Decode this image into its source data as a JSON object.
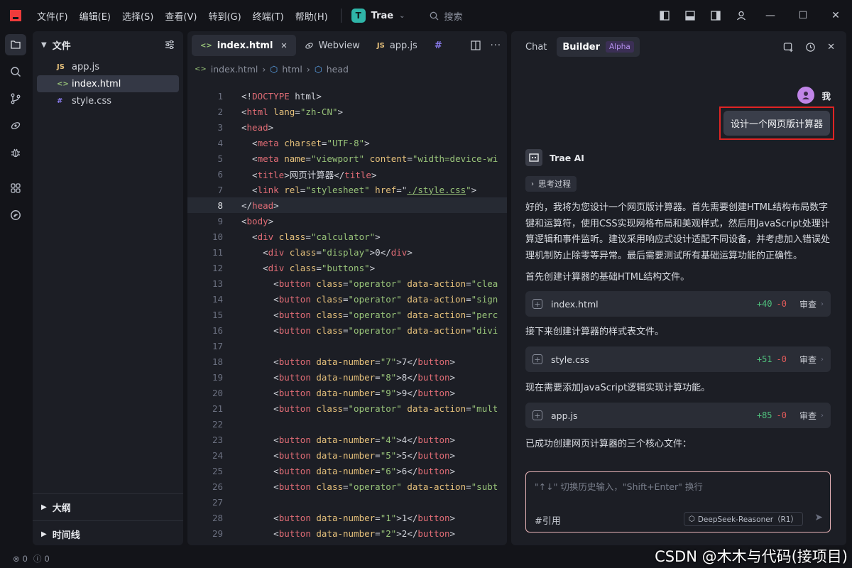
{
  "menu": [
    "文件(F)",
    "编辑(E)",
    "选择(S)",
    "查看(V)",
    "转到(G)",
    "终端(T)",
    "帮助(H)"
  ],
  "workspace": {
    "badge": "T",
    "name": "Trae"
  },
  "search": {
    "placeholder": "搜索"
  },
  "sidebar": {
    "title": "文件",
    "files": [
      {
        "icon": "JS",
        "name": "app.js",
        "color": "#e5c07b"
      },
      {
        "icon": "<>",
        "name": "index.html",
        "color": "#98c379"
      },
      {
        "icon": "#",
        "name": "style.css",
        "color": "#8b7cf0"
      }
    ],
    "outline": "大纲",
    "timeline": "时间线"
  },
  "editor": {
    "tabs": [
      {
        "icon": "<>",
        "label": "index.html"
      },
      {
        "icon": "webview",
        "label": "Webview"
      },
      {
        "icon": "JS",
        "label": "app.js"
      },
      {
        "icon": "#",
        "label": ""
      }
    ],
    "breadcrumb": [
      "index.html",
      "html",
      "head"
    ],
    "current_line": 8,
    "lines": [
      [
        [
          "pl",
          "<!"
        ],
        [
          "tag",
          "DOCTYPE"
        ],
        [
          "pl",
          " html>"
        ]
      ],
      [
        [
          "pl",
          "<"
        ],
        [
          "tag",
          "html"
        ],
        [
          "attr",
          " lang"
        ],
        [
          "pl",
          "="
        ],
        [
          "str",
          "\"zh-CN\""
        ],
        [
          "pl",
          ">"
        ]
      ],
      [
        [
          "pl",
          "<"
        ],
        [
          "tag",
          "head"
        ],
        [
          "pl",
          ">"
        ]
      ],
      [
        [
          "pl",
          "  <"
        ],
        [
          "tag",
          "meta"
        ],
        [
          "attr",
          " charset"
        ],
        [
          "pl",
          "="
        ],
        [
          "str",
          "\"UTF-8\""
        ],
        [
          "pl",
          ">"
        ]
      ],
      [
        [
          "pl",
          "  <"
        ],
        [
          "tag",
          "meta"
        ],
        [
          "attr",
          " name"
        ],
        [
          "pl",
          "="
        ],
        [
          "str",
          "\"viewport\""
        ],
        [
          "attr",
          " content"
        ],
        [
          "pl",
          "="
        ],
        [
          "str",
          "\"width=device-wi"
        ]
      ],
      [
        [
          "pl",
          "  <"
        ],
        [
          "tag",
          "title"
        ],
        [
          "pl",
          ">网页计算器</"
        ],
        [
          "tag",
          "title"
        ],
        [
          "pl",
          ">"
        ]
      ],
      [
        [
          "pl",
          "  <"
        ],
        [
          "tag",
          "link"
        ],
        [
          "attr",
          " rel"
        ],
        [
          "pl",
          "="
        ],
        [
          "str",
          "\"stylesheet\""
        ],
        [
          "attr",
          " href"
        ],
        [
          "pl",
          "=\""
        ],
        [
          "lnk",
          "./style.css"
        ],
        [
          "str",
          "\""
        ],
        [
          "pl",
          ">"
        ]
      ],
      [
        [
          "pl",
          "</"
        ],
        [
          "tag",
          "head"
        ],
        [
          "pl",
          ">"
        ]
      ],
      [
        [
          "pl",
          "<"
        ],
        [
          "tag",
          "body"
        ],
        [
          "pl",
          ">"
        ]
      ],
      [
        [
          "pl",
          "  <"
        ],
        [
          "tag",
          "div"
        ],
        [
          "attr",
          " class"
        ],
        [
          "pl",
          "="
        ],
        [
          "str",
          "\"calculator\""
        ],
        [
          "pl",
          ">"
        ]
      ],
      [
        [
          "pl",
          "    <"
        ],
        [
          "tag",
          "div"
        ],
        [
          "attr",
          " class"
        ],
        [
          "pl",
          "="
        ],
        [
          "str",
          "\"display\""
        ],
        [
          "pl",
          ">0</"
        ],
        [
          "tag",
          "div"
        ],
        [
          "pl",
          ">"
        ]
      ],
      [
        [
          "pl",
          "    <"
        ],
        [
          "tag",
          "div"
        ],
        [
          "attr",
          " class"
        ],
        [
          "pl",
          "="
        ],
        [
          "str",
          "\"buttons\""
        ],
        [
          "pl",
          ">"
        ]
      ],
      [
        [
          "pl",
          "      <"
        ],
        [
          "tag",
          "button"
        ],
        [
          "attr",
          " class"
        ],
        [
          "pl",
          "="
        ],
        [
          "str",
          "\"operator\""
        ],
        [
          "attr",
          " data-action"
        ],
        [
          "pl",
          "="
        ],
        [
          "str",
          "\"clea"
        ]
      ],
      [
        [
          "pl",
          "      <"
        ],
        [
          "tag",
          "button"
        ],
        [
          "attr",
          " class"
        ],
        [
          "pl",
          "="
        ],
        [
          "str",
          "\"operator\""
        ],
        [
          "attr",
          " data-action"
        ],
        [
          "pl",
          "="
        ],
        [
          "str",
          "\"sign"
        ]
      ],
      [
        [
          "pl",
          "      <"
        ],
        [
          "tag",
          "button"
        ],
        [
          "attr",
          " class"
        ],
        [
          "pl",
          "="
        ],
        [
          "str",
          "\"operator\""
        ],
        [
          "attr",
          " data-action"
        ],
        [
          "pl",
          "="
        ],
        [
          "str",
          "\"perc"
        ]
      ],
      [
        [
          "pl",
          "      <"
        ],
        [
          "tag",
          "button"
        ],
        [
          "attr",
          " class"
        ],
        [
          "pl",
          "="
        ],
        [
          "str",
          "\"operator\""
        ],
        [
          "attr",
          " data-action"
        ],
        [
          "pl",
          "="
        ],
        [
          "str",
          "\"divi"
        ]
      ],
      [],
      [
        [
          "pl",
          "      <"
        ],
        [
          "tag",
          "button"
        ],
        [
          "attr",
          " data-number"
        ],
        [
          "pl",
          "="
        ],
        [
          "str",
          "\"7\""
        ],
        [
          "pl",
          ">7</"
        ],
        [
          "tag",
          "button"
        ],
        [
          "pl",
          ">"
        ]
      ],
      [
        [
          "pl",
          "      <"
        ],
        [
          "tag",
          "button"
        ],
        [
          "attr",
          " data-number"
        ],
        [
          "pl",
          "="
        ],
        [
          "str",
          "\"8\""
        ],
        [
          "pl",
          ">8</"
        ],
        [
          "tag",
          "button"
        ],
        [
          "pl",
          ">"
        ]
      ],
      [
        [
          "pl",
          "      <"
        ],
        [
          "tag",
          "button"
        ],
        [
          "attr",
          " data-number"
        ],
        [
          "pl",
          "="
        ],
        [
          "str",
          "\"9\""
        ],
        [
          "pl",
          ">9</"
        ],
        [
          "tag",
          "button"
        ],
        [
          "pl",
          ">"
        ]
      ],
      [
        [
          "pl",
          "      <"
        ],
        [
          "tag",
          "button"
        ],
        [
          "attr",
          " class"
        ],
        [
          "pl",
          "="
        ],
        [
          "str",
          "\"operator\""
        ],
        [
          "attr",
          " data-action"
        ],
        [
          "pl",
          "="
        ],
        [
          "str",
          "\"mult"
        ]
      ],
      [],
      [
        [
          "pl",
          "      <"
        ],
        [
          "tag",
          "button"
        ],
        [
          "attr",
          " data-number"
        ],
        [
          "pl",
          "="
        ],
        [
          "str",
          "\"4\""
        ],
        [
          "pl",
          ">4</"
        ],
        [
          "tag",
          "button"
        ],
        [
          "pl",
          ">"
        ]
      ],
      [
        [
          "pl",
          "      <"
        ],
        [
          "tag",
          "button"
        ],
        [
          "attr",
          " data-number"
        ],
        [
          "pl",
          "="
        ],
        [
          "str",
          "\"5\""
        ],
        [
          "pl",
          ">5</"
        ],
        [
          "tag",
          "button"
        ],
        [
          "pl",
          ">"
        ]
      ],
      [
        [
          "pl",
          "      <"
        ],
        [
          "tag",
          "button"
        ],
        [
          "attr",
          " data-number"
        ],
        [
          "pl",
          "="
        ],
        [
          "str",
          "\"6\""
        ],
        [
          "pl",
          ">6</"
        ],
        [
          "tag",
          "button"
        ],
        [
          "pl",
          ">"
        ]
      ],
      [
        [
          "pl",
          "      <"
        ],
        [
          "tag",
          "button"
        ],
        [
          "attr",
          " class"
        ],
        [
          "pl",
          "="
        ],
        [
          "str",
          "\"operator\""
        ],
        [
          "attr",
          " data-action"
        ],
        [
          "pl",
          "="
        ],
        [
          "str",
          "\"subt"
        ]
      ],
      [],
      [
        [
          "pl",
          "      <"
        ],
        [
          "tag",
          "button"
        ],
        [
          "attr",
          " data-number"
        ],
        [
          "pl",
          "="
        ],
        [
          "str",
          "\"1\""
        ],
        [
          "pl",
          ">1</"
        ],
        [
          "tag",
          "button"
        ],
        [
          "pl",
          ">"
        ]
      ],
      [
        [
          "pl",
          "      <"
        ],
        [
          "tag",
          "button"
        ],
        [
          "attr",
          " data-number"
        ],
        [
          "pl",
          "="
        ],
        [
          "str",
          "\"2\""
        ],
        [
          "pl",
          ">2</"
        ],
        [
          "tag",
          "button"
        ],
        [
          "pl",
          ">"
        ]
      ]
    ]
  },
  "chat": {
    "tabs": {
      "chat": "Chat",
      "builder": "Builder",
      "alpha": "Alpha"
    },
    "user": {
      "name": "我",
      "message": "设计一个网页版计算器"
    },
    "ai": {
      "name": "Trae AI",
      "think": "思考过程"
    },
    "paragraphs": [
      "好的，我将为您设计一个网页版计算器。首先需要创建HTML结构布局数字键和运算符，使用CSS实现网格布局和美观样式，然后用JavaScript处理计算逻辑和事件监听。建议采用响应式设计适配不同设备，并考虑加入错误处理机制防止除零等异常。最后需要测试所有基础运算功能的正确性。",
      "首先创建计算器的基础HTML结构文件。",
      "接下来创建计算器的样式表文件。",
      "现在需要添加JavaScript逻辑实现计算功能。",
      "已成功创建网页计算器的三个核心文件："
    ],
    "files": [
      {
        "name": "index.html",
        "add": "+40",
        "del": "-0",
        "review": "审查"
      },
      {
        "name": "style.css",
        "add": "+51",
        "del": "-0",
        "review": "审查"
      },
      {
        "name": "app.js",
        "add": "+85",
        "del": "-0",
        "review": "审查"
      }
    ],
    "input": {
      "placeholder": "\"↑↓\" 切换历史输入，\"Shift+Enter\" 换行",
      "ref": "#引用",
      "model": "DeepSeek-Reasoner（R1）"
    }
  },
  "status": {
    "errors": "0",
    "warnings": "0"
  },
  "watermark": "CSDN @木木与代码(接项目)"
}
